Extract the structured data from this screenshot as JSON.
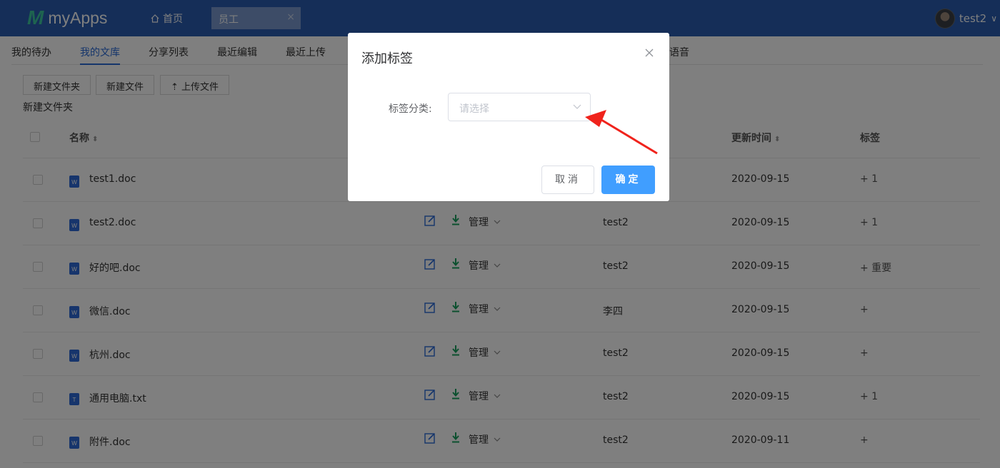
{
  "header": {
    "logo_mark": "M",
    "app_name": "myApps",
    "home_label": "首页",
    "open_tab": "员工",
    "open_tab_close": "×",
    "user_name": "test2",
    "caret": "∨"
  },
  "subnav": {
    "items": [
      "我的待办",
      "我的文库",
      "分享列表",
      "最近编辑",
      "最近上传"
    ],
    "hidden_item_tail": "语音",
    "active_index": 1
  },
  "toolbar": {
    "new_folder": "新建文件夹",
    "new_file": "新建文件",
    "upload": "上传文件",
    "breadcrumb": "新建文件夹"
  },
  "table": {
    "headers": {
      "name": "名称",
      "updated": "更新时间",
      "tags": "标签"
    },
    "manage_label": "管理",
    "rows": [
      {
        "type": "W",
        "name": "test1.doc",
        "owner": "",
        "date": "2020-09-15",
        "tag": "+  1"
      },
      {
        "type": "W",
        "name": "test2.doc",
        "owner": "test2",
        "date": "2020-09-15",
        "tag": "+  1"
      },
      {
        "type": "W",
        "name": "好的吧.doc",
        "owner": "test2",
        "date": "2020-09-15",
        "tag": "+  重要"
      },
      {
        "type": "W",
        "name": "微信.doc",
        "owner": "李四",
        "date": "2020-09-15",
        "tag": "+"
      },
      {
        "type": "W",
        "name": "杭州.doc",
        "owner": "test2",
        "date": "2020-09-15",
        "tag": "+"
      },
      {
        "type": "T",
        "name": "通用电脑.txt",
        "owner": "test2",
        "date": "2020-09-15",
        "tag": "+  1"
      },
      {
        "type": "W",
        "name": "附件.doc",
        "owner": "test2",
        "date": "2020-09-11",
        "tag": "+"
      }
    ]
  },
  "dialog": {
    "title": "添加标签",
    "field_label": "标签分类:",
    "select_placeholder": "请选择",
    "cancel_label": "取消",
    "ok_label": "确定"
  },
  "colors": {
    "header_bg": "#2a5db0",
    "primary": "#409eff",
    "link_active": "#2a6ad6",
    "download_green": "#19a15f",
    "annotation_red": "#f0231c"
  }
}
